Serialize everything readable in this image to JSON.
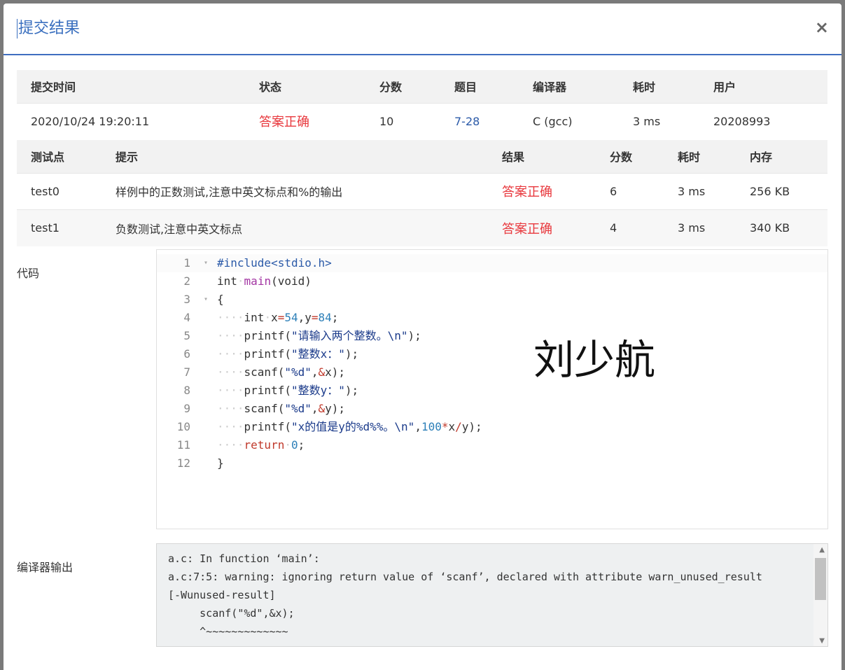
{
  "modal": {
    "title": "提交结果",
    "close_label": "×"
  },
  "summary": {
    "headers": [
      "提交时间",
      "状态",
      "分数",
      "题目",
      "编译器",
      "耗时",
      "用户"
    ],
    "row": {
      "time": "2020/10/24 19:20:11",
      "status": "答案正确",
      "score": "10",
      "problem": "7-28",
      "compiler": "C (gcc)",
      "elapsed": "3 ms",
      "user": "20208993"
    }
  },
  "tests": {
    "headers": [
      "测试点",
      "提示",
      "结果",
      "分数",
      "耗时",
      "内存"
    ],
    "rows": [
      {
        "id": "test0",
        "hint": "样例中的正数测试,注意中英文标点和%的输出",
        "result": "答案正确",
        "score": "6",
        "time": "3 ms",
        "memory": "256 KB"
      },
      {
        "id": "test1",
        "hint": "负数测试,注意中英文标点",
        "result": "答案正确",
        "score": "4",
        "time": "3 ms",
        "memory": "340 KB"
      }
    ]
  },
  "code": {
    "label": "代码",
    "line_numbers": [
      "1",
      "2",
      "3",
      "4",
      "5",
      "6",
      "7",
      "8",
      "9",
      "10",
      "11",
      "12"
    ],
    "watermark": "刘少航"
  },
  "compiler_output": {
    "label": "编译器输出",
    "lines": [
      "a.c: In function ‘main’:",
      "a.c:7:5: warning: ignoring return value of ‘scanf’, declared with attribute warn_unused_result",
      "[-Wunused-result]",
      "     scanf(\"%d\",&x);",
      "     ^~~~~~~~~~~~~~"
    ]
  },
  "colors": {
    "accent": "#3a6fbf",
    "success_red": "#e8383d",
    "link": "#2b5aa8"
  }
}
